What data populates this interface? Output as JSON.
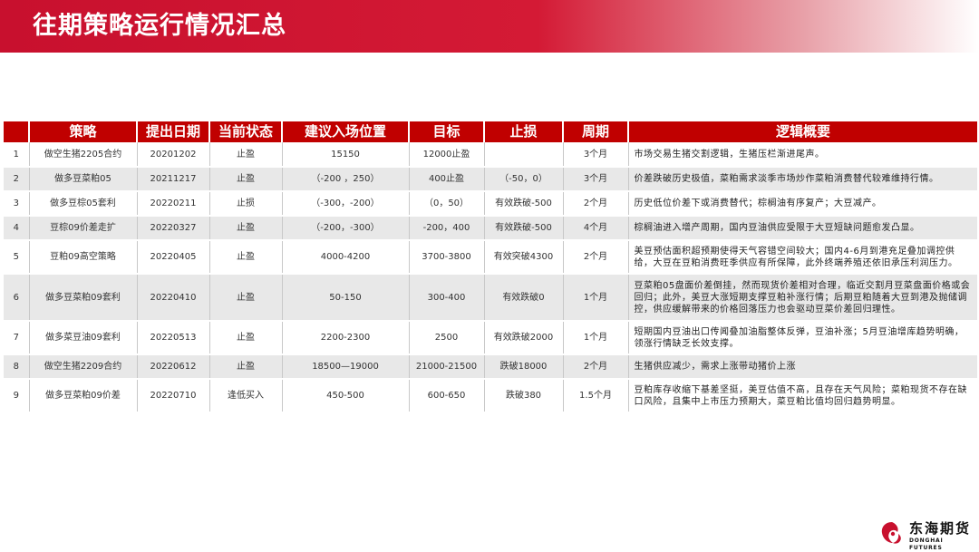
{
  "title": "往期策略运行情况汇总",
  "columns": [
    "",
    "策略",
    "提出日期",
    "当前状态",
    "建议入场位置",
    "目标",
    "止损",
    "周期",
    "逻辑概要"
  ],
  "rows": [
    {
      "no": "1",
      "strategy": "做空生猪2205合约",
      "date": "20201202",
      "status": "止盈",
      "entry": "15150",
      "target": "12000止盈",
      "stop": "",
      "period": "3个月",
      "logic": "市场交易生猪交割逻辑，生猪压栏渐进尾声。"
    },
    {
      "no": "2",
      "strategy": "做多豆菜粕05",
      "date": "20211217",
      "status": "止盈",
      "entry": "（-200 ，250）",
      "target": "400止盈",
      "stop": "（-50，0）",
      "period": "3个月",
      "logic": "价差跌破历史极值，菜粕需求淡季市场炒作菜粕消费替代较难维持行情。"
    },
    {
      "no": "3",
      "strategy": "做多豆棕05套利",
      "date": "20220211",
      "status": "止损",
      "entry": "（-300，-200）",
      "target": "（0，50）",
      "stop": "有效跌破-500",
      "period": "2个月",
      "logic": "历史低位价差下或消费替代；棕榈油有序复产；大豆减产。"
    },
    {
      "no": "4",
      "strategy": "豆棕09价差走扩",
      "date": "20220327",
      "status": "止盈",
      "entry": "（-200，-300）",
      "target": "-200，400",
      "stop": "有效跌破-500",
      "period": "4个月",
      "logic": "棕榈油进入增产周期，国内豆油供应受限于大豆短缺问题愈发凸显。"
    },
    {
      "no": "5",
      "strategy": "豆粕09高空策略",
      "date": "20220405",
      "status": "止盈",
      "entry": "4000-4200",
      "target": "3700-3800",
      "stop": "有效突破4300",
      "period": "2个月",
      "logic": "美豆预估面积超预期使得天气容错空间较大；国内4-6月到港充足叠加调控供给，大豆在豆粕消费旺季供应有所保障，此外终端养殖还依旧承压利润压力。"
    },
    {
      "no": "6",
      "strategy": "做多豆菜粕09套利",
      "date": "20220410",
      "status": "止盈",
      "entry": "50-150",
      "target": "300-400",
      "stop": "有效跌破0",
      "period": "1个月",
      "logic": "豆菜粕05盘面价差倒挂，然而现货价差相对合理，临近交割月豆菜盘面价格或会回归；此外，美豆大涨短期支撑豆粕补涨行情；后期豆粕随着大豆到港及抛储调控，供应缓解带来的价格回落压力也会驱动豆菜价差回归理性。"
    },
    {
      "no": "7",
      "strategy": "做多菜豆油09套利",
      "date": "20220513",
      "status": "止盈",
      "entry": "2200-2300",
      "target": "2500",
      "stop": "有效跌破2000",
      "period": "1个月",
      "logic": "短期国内豆油出口传闻叠加油脂整体反弹，豆油补涨；5月豆油增库趋势明确，领涨行情缺乏长效支撑。"
    },
    {
      "no": "8",
      "strategy": "做空生猪2209合约",
      "date": "20220612",
      "status": "止盈",
      "entry": "18500—19000",
      "target": "21000-21500",
      "stop": "跌破18000",
      "period": "2个月",
      "logic": "生猪供应减少，需求上涨带动猪价上涨"
    },
    {
      "no": "9",
      "strategy": "做多豆菜粕09价差",
      "date": "20220710",
      "status": "逢低买入",
      "entry": "450-500",
      "target": "600-650",
      "stop": "跌破380",
      "period": "1.5个月",
      "logic": "豆粕库存收缩下基差坚挺，美豆估值不高，且存在天气风险；菜粕现货不存在缺口风险，且集中上市压力预期大，菜豆粕比值均回归趋势明显。"
    }
  ],
  "logo": {
    "name_cn": "东海期货",
    "name_en": "DONGHAI FUTURES"
  },
  "colors": {
    "header_red": "#c00000",
    "title_red": "#c8102e",
    "stripe_gray": "#e8e8e8"
  }
}
